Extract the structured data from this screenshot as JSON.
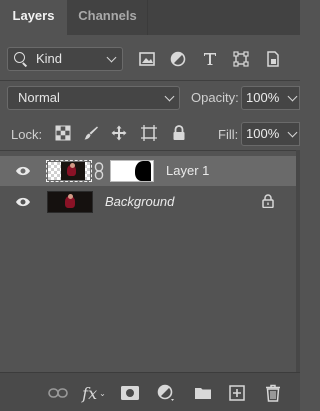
{
  "tabs": [
    {
      "label": "Layers"
    },
    {
      "label": "Channels"
    }
  ],
  "filter": {
    "kind_label": "Kind"
  },
  "blend": {
    "mode": "Normal",
    "opacity_label": "Opacity:",
    "opacity_value": "100%"
  },
  "lock": {
    "label": "Lock:",
    "fill_label": "Fill:",
    "fill_value": "100%"
  },
  "layers": [
    {
      "name": "Layer 1",
      "selected": true,
      "visible": true,
      "has_mask": true
    },
    {
      "name": "Background",
      "selected": false,
      "visible": true,
      "locked": true
    }
  ],
  "colors": {
    "panel_bg": "#535353",
    "tab_bg": "#424242",
    "selected_row": "#6a6a6a"
  }
}
